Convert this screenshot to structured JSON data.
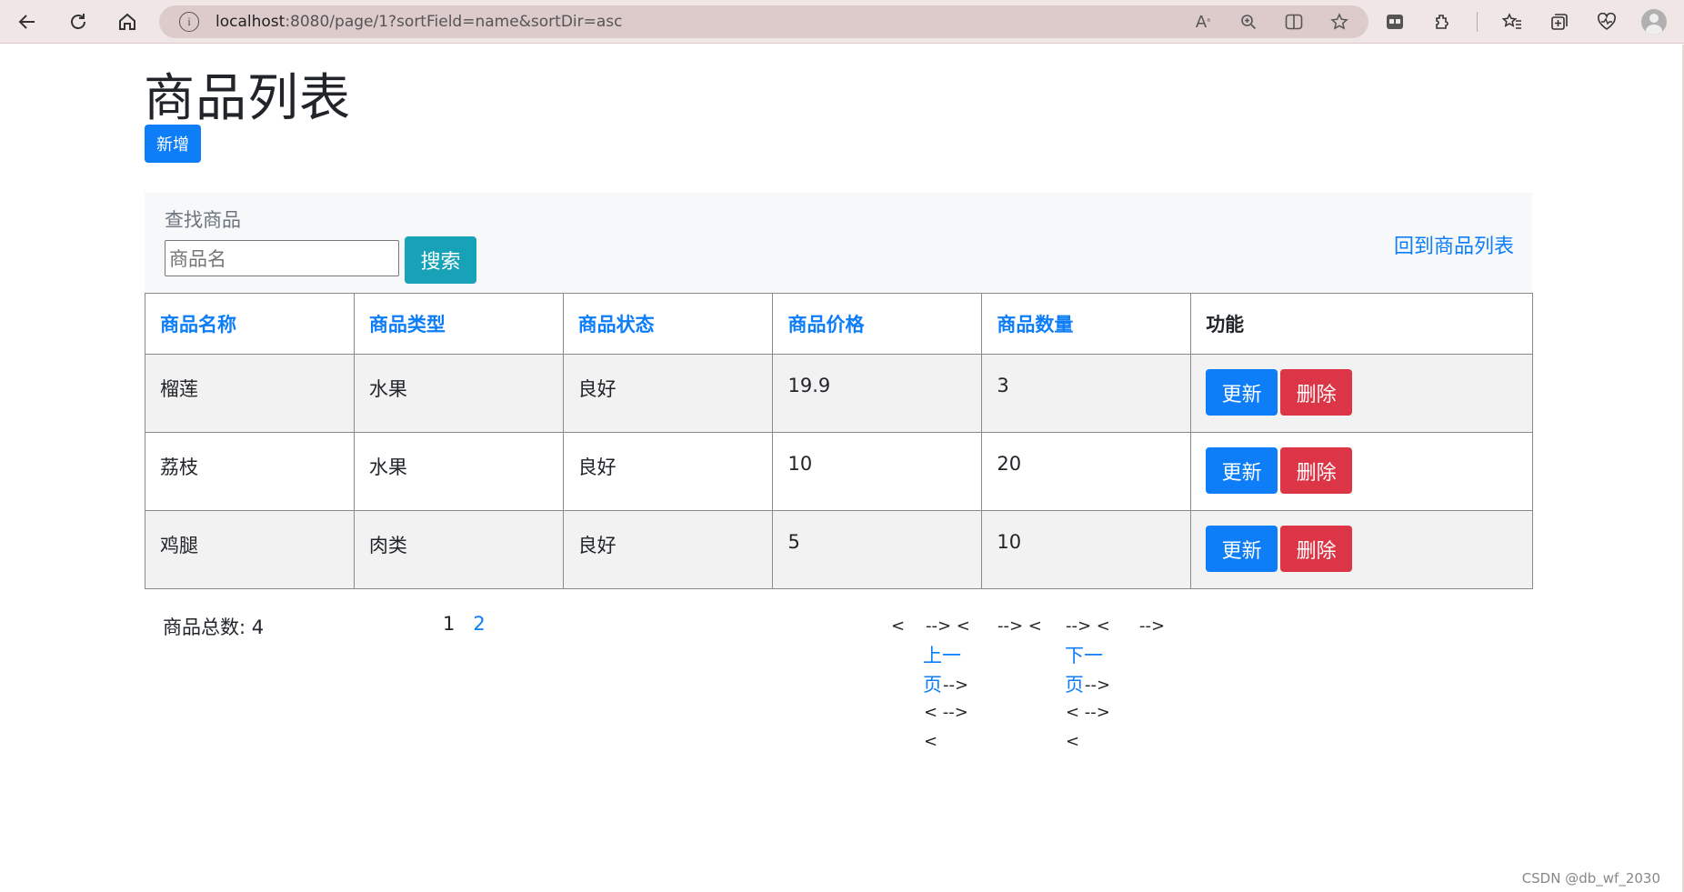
{
  "browser": {
    "url_host": "localhost",
    "url_path": ":8080/page/1?sortField=name&sortDir=asc",
    "address_icons": [
      "read-aloud-icon",
      "zoom-icon",
      "split-screen-icon",
      "favorite-star-icon"
    ],
    "toolbar_icons": [
      "workspaces-icon",
      "extensions-icon",
      "favorites-icon",
      "collections-icon",
      "health-icon",
      "profile-icon"
    ]
  },
  "page": {
    "title": "商品列表",
    "add_button": "新增"
  },
  "search": {
    "label": "查找商品",
    "placeholder": "商品名",
    "button": "搜索",
    "back_link": "回到商品列表"
  },
  "table": {
    "headers": [
      "商品名称",
      "商品类型",
      "商品状态",
      "商品价格",
      "商品数量",
      "功能"
    ],
    "rows": [
      {
        "name": "榴莲",
        "type": "水果",
        "status": "良好",
        "price": "19.9",
        "qty": "3"
      },
      {
        "name": "荔枝",
        "type": "水果",
        "status": "良好",
        "price": "10",
        "qty": "20"
      },
      {
        "name": "鸡腿",
        "type": "肉类",
        "status": "良好",
        "price": "5",
        "qty": "10"
      }
    ],
    "update_label": "更新",
    "delete_label": "删除"
  },
  "footer": {
    "total_label": "商品总数: 4",
    "page_current": "1",
    "page_next": "2"
  },
  "pager_fragments": {
    "row1a": "<    --> <",
    "row1b": "--> <",
    "row1c": "--> <",
    "row1d": "-->",
    "prev_line1": "上一",
    "prev_line2": "页",
    "prev_tail": "-->",
    "next_line1": "下一",
    "next_line2": "页",
    "next_tail": "-->",
    "left_r3": "< -->",
    "left_r4": "<",
    "right_r3": "< -->",
    "right_r4": "<"
  },
  "watermark": "CSDN @db_wf_2030"
}
